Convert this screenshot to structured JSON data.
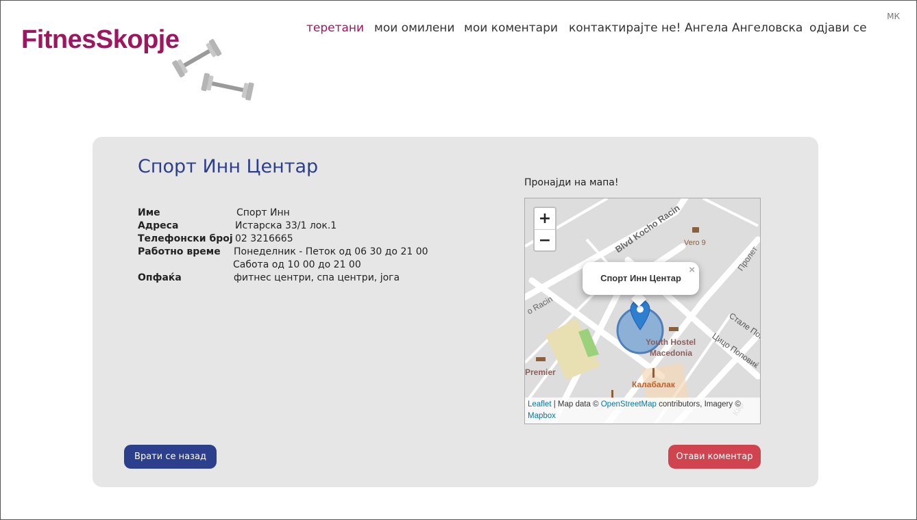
{
  "logo": {
    "text": "FitnesSkopje"
  },
  "lang": "МК",
  "nav": {
    "items": [
      {
        "label": "теретани",
        "active": true
      },
      {
        "label": "мои омилени"
      },
      {
        "label": "мои коментари"
      },
      {
        "label": "контактирајте не!"
      },
      {
        "label": "Ангела Ангеловска"
      },
      {
        "label": "одјави се"
      }
    ]
  },
  "gym": {
    "title": "Спорт Инн Центар",
    "rows": [
      {
        "label": "Име",
        "value": "Спорт Инн"
      },
      {
        "label": "Адреса",
        "value": "Истарска 33/1 лок.1"
      },
      {
        "label": "Телефонски број",
        "value": "02 3216665"
      },
      {
        "label": "Работно време",
        "value": "Понеделник - Петок од 06 30 до 21 00"
      },
      {
        "label": "",
        "value": "Сабота од 10 00 до 21 00"
      },
      {
        "label": "Опфаќа",
        "value": "фитнес центри, спа центри, јога"
      }
    ]
  },
  "map": {
    "label": "Пронајди на мапа!",
    "zoom_in": "+",
    "zoom_out": "−",
    "popup_title": "Спорт Инн Центар",
    "popup_close": "×",
    "street_labels": [
      "Blvd Kocho Racin",
      "Пролет",
      "Vero 9",
      "o Racin",
      "Youth Hostel",
      "Macedonia",
      "Цицо Поповиќ",
      "Стале Попов",
      "Premier",
      "Калабалак",
      "Кар"
    ],
    "attribution": {
      "leaflet": "Leaflet",
      "sep": " | Map data © ",
      "osm": "OpenStreetMap",
      "rest": " contributors, Imagery © ",
      "mapbox": "Mapbox"
    }
  },
  "buttons": {
    "back": "Врати се назад",
    "comment": "Отави коментар"
  },
  "colors": {
    "brand": "#9c1660",
    "primary": "#2b3f8c",
    "danger": "#d0444f",
    "card_bg": "#e6e6e6"
  }
}
